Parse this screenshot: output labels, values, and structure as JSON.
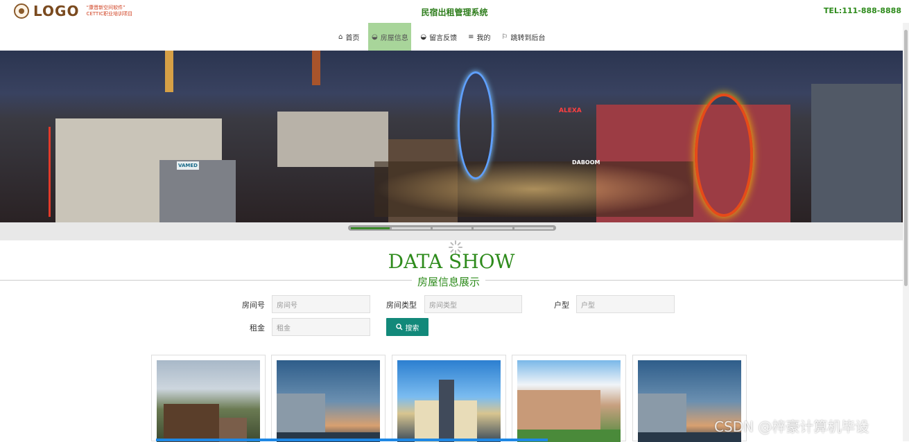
{
  "header": {
    "logo_text": "LOGO",
    "logo_sub_1": "“康晋新空间软件”",
    "logo_sub_2": "CETTIC职业培训项目",
    "system_title": "民宿出租管理系统",
    "tel": "TEL:111-888-8888"
  },
  "nav": {
    "items": [
      {
        "label": "首页",
        "icon": "home-icon"
      },
      {
        "label": "房屋信息",
        "icon": "layers-icon",
        "active": true
      },
      {
        "label": "留言反馈",
        "icon": "layers-icon"
      },
      {
        "label": "我的",
        "icon": "menu-icon"
      },
      {
        "label": "跳转到后台",
        "icon": "flag-icon"
      }
    ]
  },
  "banner": {
    "sign_alexa": "ALEXA",
    "sign_dabo": "DABOOM",
    "sign_vamed": "VAMED",
    "slide_count": 5,
    "active_slide": 1
  },
  "section": {
    "title": "DATA SHOW",
    "subtitle": "房屋信息展示"
  },
  "search": {
    "room_no_label": "房间号",
    "room_no_placeholder": "房间号",
    "room_type_label": "房间类型",
    "room_type_placeholder": "房间类型",
    "layout_label": "户型",
    "layout_placeholder": "户型",
    "rent_label": "租金",
    "rent_placeholder": "租金",
    "search_button": "搜索"
  },
  "watermark": "CSDN @梓豪计算机毕设",
  "colors": {
    "accent_green": "#2e8b1c",
    "nav_active": "#a8d59a",
    "search_button": "#12897a"
  }
}
